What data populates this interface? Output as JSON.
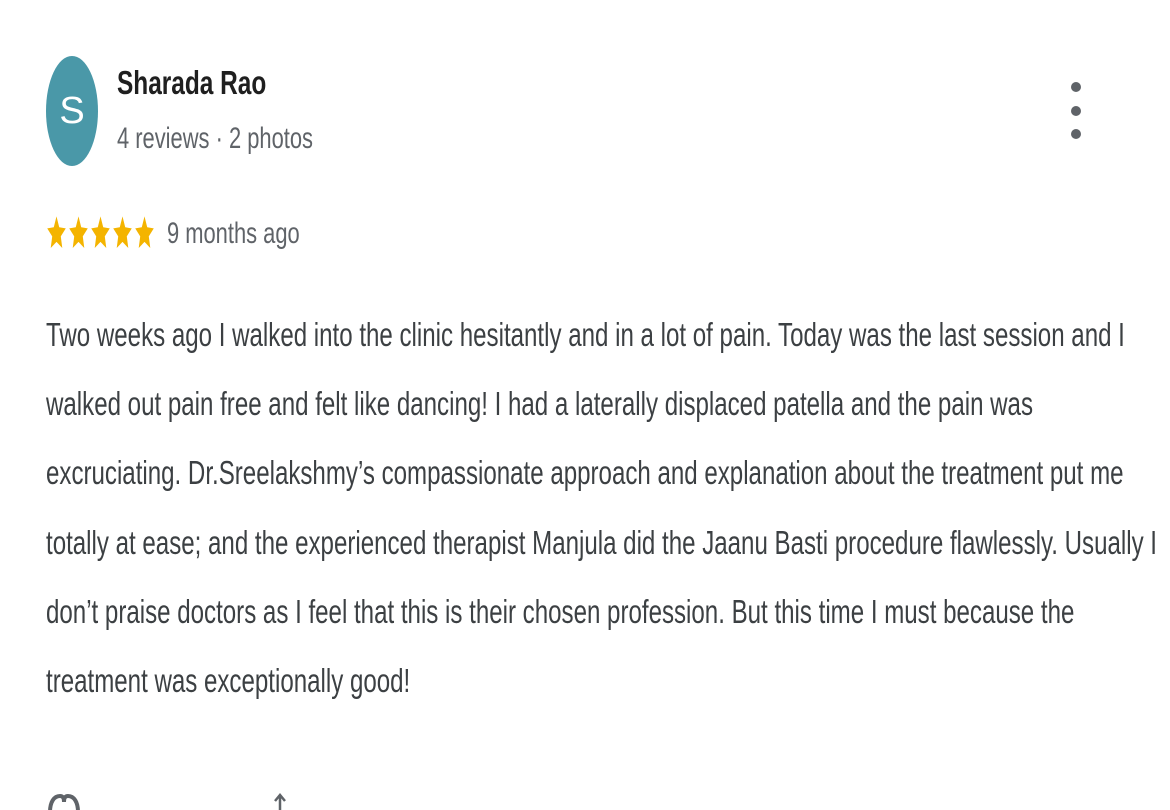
{
  "reviewer": {
    "initial": "S",
    "name": "Sharada Rao",
    "meta": "4 reviews · 2 photos",
    "avatar_color": "#4a98a8"
  },
  "rating": {
    "stars": 5,
    "max": 5,
    "star_color": "#f4b400",
    "time_ago": "9 months ago"
  },
  "review": {
    "lines": [
      "Two weeks ago I walked into the clinic hesitantly and in a lot of pain. Today was the last session and I",
      "walked out pain free and felt like dancing! I had a laterally displaced patella and the pain was",
      "excruciating. Dr.Sreelakshmy’s compassionate approach and explanation about the treatment put me",
      "totally at ease; and the experienced therapist Manjula did the Jaanu Basti procedure flawlessly. Usually I",
      "don’t praise doctors as I feel that this is their chosen profession. But this time I must because the",
      "treatment was exceptionally good!"
    ]
  },
  "icons": {
    "more": "more-vert-icon",
    "like": "thumb-up-icon",
    "share": "share-icon"
  },
  "colors": {
    "text_primary": "#1f1f1f",
    "text_secondary": "#5f6368",
    "body_text": "#3c4043"
  }
}
